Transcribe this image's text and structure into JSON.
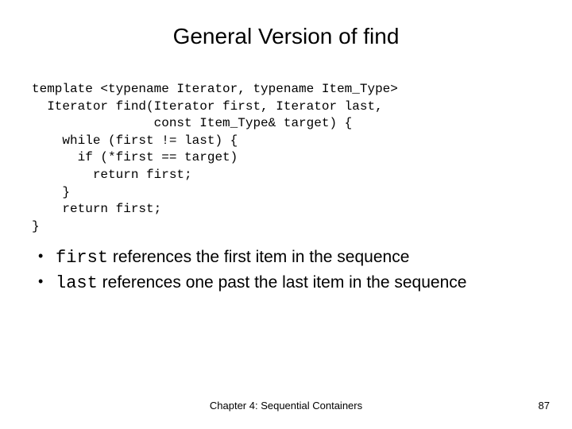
{
  "title": "General Version of find",
  "code": {
    "l1": "template <typename Iterator, typename Item_Type>",
    "l2": "  Iterator find(Iterator first, Iterator last,",
    "l3": "                const Item_Type& target) {",
    "l4": "    while (first != last) {",
    "l5": "      if (*first == target)",
    "l6": "        return first;",
    "l7": "    }",
    "l8": "    return first;",
    "l9": "}"
  },
  "bullets": [
    {
      "code": "first",
      "rest": " references the first item in the sequence"
    },
    {
      "code": "last",
      "rest": "  references one past the last item in the sequence"
    }
  ],
  "footer": {
    "chapter": "Chapter 4: Sequential Containers",
    "page": "87"
  }
}
